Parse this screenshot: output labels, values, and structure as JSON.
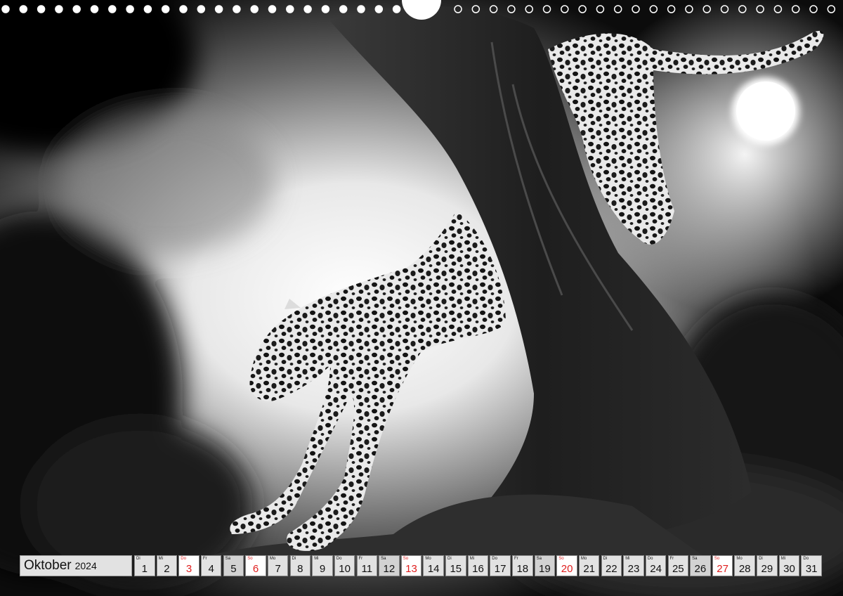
{
  "colors": {
    "weekday_bg": "#e2e2e2",
    "saturday_bg": "#d2d2d2",
    "sunday_bg": "#ffffff",
    "sunday_text": "#e01e1e",
    "binding_hole": "#ffffff"
  },
  "photo": {
    "subject_icon": "leopard-in-tree-photo",
    "moon_icon": "full-moon-icon"
  },
  "binding": {
    "hole_count": 48,
    "hanger_icon": "calendar-hanger-icon"
  },
  "calendar": {
    "month": "Oktober",
    "year": "2024",
    "days": [
      {
        "wd": "Di",
        "n": "1",
        "type": "weekday"
      },
      {
        "wd": "Mi",
        "n": "2",
        "type": "weekday"
      },
      {
        "wd": "Do",
        "n": "3",
        "type": "sunday"
      },
      {
        "wd": "Fr",
        "n": "4",
        "type": "weekday"
      },
      {
        "wd": "Sa",
        "n": "5",
        "type": "saturday"
      },
      {
        "wd": "So",
        "n": "6",
        "type": "sunday"
      },
      {
        "wd": "Mo",
        "n": "7",
        "type": "weekday"
      },
      {
        "wd": "Di",
        "n": "8",
        "type": "weekday"
      },
      {
        "wd": "Mi",
        "n": "9",
        "type": "weekday"
      },
      {
        "wd": "Do",
        "n": "10",
        "type": "weekday"
      },
      {
        "wd": "Fr",
        "n": "11",
        "type": "weekday"
      },
      {
        "wd": "Sa",
        "n": "12",
        "type": "saturday"
      },
      {
        "wd": "So",
        "n": "13",
        "type": "sunday"
      },
      {
        "wd": "Mo",
        "n": "14",
        "type": "weekday"
      },
      {
        "wd": "Di",
        "n": "15",
        "type": "weekday"
      },
      {
        "wd": "Mi",
        "n": "16",
        "type": "weekday"
      },
      {
        "wd": "Do",
        "n": "17",
        "type": "weekday"
      },
      {
        "wd": "Fr",
        "n": "18",
        "type": "weekday"
      },
      {
        "wd": "Sa",
        "n": "19",
        "type": "saturday"
      },
      {
        "wd": "So",
        "n": "20",
        "type": "sunday"
      },
      {
        "wd": "Mo",
        "n": "21",
        "type": "weekday"
      },
      {
        "wd": "Di",
        "n": "22",
        "type": "weekday"
      },
      {
        "wd": "Mi",
        "n": "23",
        "type": "weekday"
      },
      {
        "wd": "Do",
        "n": "24",
        "type": "weekday"
      },
      {
        "wd": "Fr",
        "n": "25",
        "type": "weekday"
      },
      {
        "wd": "Sa",
        "n": "26",
        "type": "saturday"
      },
      {
        "wd": "So",
        "n": "27",
        "type": "sunday"
      },
      {
        "wd": "Mo",
        "n": "28",
        "type": "weekday"
      },
      {
        "wd": "Di",
        "n": "29",
        "type": "weekday"
      },
      {
        "wd": "Mi",
        "n": "30",
        "type": "weekday"
      },
      {
        "wd": "Do",
        "n": "31",
        "type": "weekday"
      }
    ]
  }
}
